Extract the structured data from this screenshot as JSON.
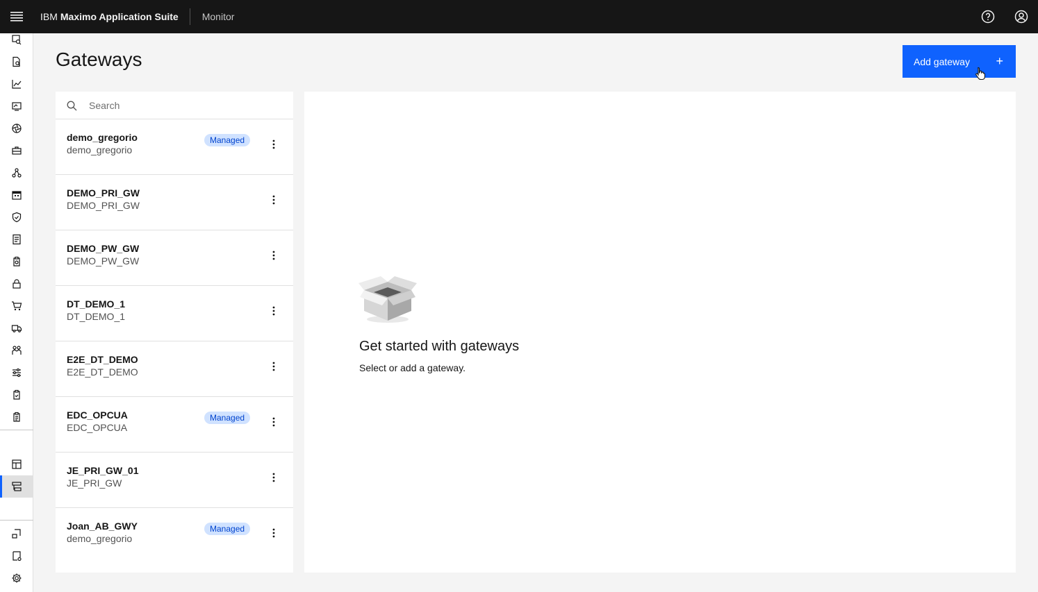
{
  "header": {
    "brand_prefix": "IBM",
    "brand_name": "Maximo Application Suite",
    "app_name": "Monitor",
    "menu_icon": "hamburger-menu-icon",
    "help_icon": "help-icon",
    "user_icon": "user-avatar-icon"
  },
  "sidenav": {
    "items": [
      {
        "icon": "monitor-search-icon",
        "active": false
      },
      {
        "icon": "document-search-icon",
        "active": false
      },
      {
        "icon": "line-chart-icon",
        "active": false
      },
      {
        "icon": "screen-icon",
        "active": false
      },
      {
        "icon": "aperture-icon",
        "active": false
      },
      {
        "icon": "toolbox-icon",
        "active": false
      },
      {
        "icon": "hierarchy-icon",
        "active": false
      },
      {
        "icon": "calendar-icon",
        "active": false
      },
      {
        "icon": "shield-check-icon",
        "active": false
      },
      {
        "icon": "receipt-icon",
        "active": false
      },
      {
        "icon": "clipboard-search-icon",
        "active": false
      },
      {
        "icon": "lock-icon",
        "active": false
      },
      {
        "icon": "shopping-cart-icon",
        "active": false
      },
      {
        "icon": "truck-icon",
        "active": false
      },
      {
        "icon": "people-icon",
        "active": false
      },
      {
        "icon": "sliders-icon",
        "active": false
      },
      {
        "icon": "clipboard-check-icon",
        "active": false
      },
      {
        "icon": "clipboard-list-icon",
        "active": false
      },
      {
        "icon": "dashboard-icon",
        "active": false
      },
      {
        "icon": "gateway-icon",
        "active": true
      },
      {
        "icon": "device-link-icon",
        "active": false
      },
      {
        "icon": "page-settings-icon",
        "active": false
      },
      {
        "icon": "settings-icon",
        "active": false
      }
    ]
  },
  "page": {
    "title": "Gateways",
    "add_button_label": "Add gateway",
    "add_button_icon": "+"
  },
  "search": {
    "placeholder": "Search"
  },
  "gateways": [
    {
      "name": "demo_gregorio",
      "sub": "demo_gregorio",
      "tag": "Managed"
    },
    {
      "name": "DEMO_PRI_GW",
      "sub": "DEMO_PRI_GW",
      "tag": ""
    },
    {
      "name": "DEMO_PW_GW",
      "sub": "DEMO_PW_GW",
      "tag": ""
    },
    {
      "name": "DT_DEMO_1",
      "sub": "DT_DEMO_1",
      "tag": ""
    },
    {
      "name": "E2E_DT_DEMO",
      "sub": "E2E_DT_DEMO",
      "tag": ""
    },
    {
      "name": "EDC_OPCUA",
      "sub": "EDC_OPCUA",
      "tag": "Managed"
    },
    {
      "name": "JE_PRI_GW_01",
      "sub": "JE_PRI_GW",
      "tag": ""
    },
    {
      "name": "Joan_AB_GWY",
      "sub": "demo_gregorio",
      "tag": "Managed"
    }
  ],
  "empty_state": {
    "title": "Get started with gateways",
    "subtitle": "Select or add a gateway.",
    "icon": "open-box-icon"
  },
  "colors": {
    "header_bg": "#161616",
    "primary": "#0f62fe",
    "tag_bg": "#d0e2ff",
    "tag_text": "#0043ce",
    "page_bg": "#f4f4f4"
  }
}
